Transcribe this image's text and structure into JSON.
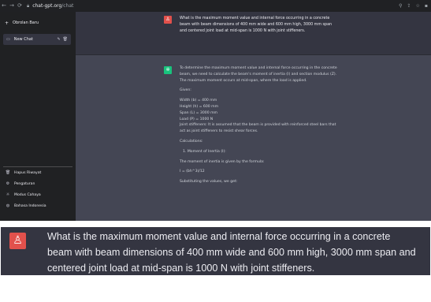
{
  "browser": {
    "back_icon": "back-arrow-icon",
    "forward_icon": "forward-arrow-icon",
    "reload_icon": "reload-icon",
    "url_host": "chat-gpt.org",
    "url_path": "/chat",
    "right_icons": [
      "search-icon",
      "share-icon",
      "star-icon",
      "extension-icon"
    ]
  },
  "sidebar": {
    "new_chat_label": "Obrolan Baru",
    "chat_items": [
      {
        "label": "New Chat"
      }
    ],
    "footer": [
      {
        "label": "Hapus Riwayat",
        "icon": "trash-icon"
      },
      {
        "label": "Pengaturan",
        "icon": "settings-icon"
      },
      {
        "label": "Modus Cahaya",
        "icon": "sun-icon"
      },
      {
        "label": "Bahasa Indonesia",
        "icon": "globe-icon"
      }
    ]
  },
  "conversation": {
    "user_message": "What is the maximum moment value and internal force occurring in a concrete beam with beam dimensions of 400 mm wide and 600 mm high, 3000 mm span and centered joint load at mid-span is 1000 N with joint stiffeners.",
    "bot_paragraphs": [
      "To determine the maximum moment value and internal force occurring in the concrete beam, we need to calculate the beam's moment of inertia (I) and section modulus (Z). The maximum moment occurs at mid-span, where the load is applied.",
      "Given:",
      "Width (b) = 400 mm\nHeight (h) = 600 mm\nSpan (L) = 3000 mm\nLoad (P) = 1000 N\nJoint stiffeners: It is assumed that the beam is provided with reinforced steel bars that act as joint stiffeners to resist shear forces.",
      "Calculations:",
      "1.  Moment of Inertia (I):",
      "The moment of inertia is given by the formula:",
      "I = (bh^3)/12",
      "Substituting the values, we get:"
    ]
  },
  "zoom": {
    "user_message": "What is the maximum moment value and internal force occurring in a concrete beam with beam dimensions of 400 mm wide and 600 mm high, 3000 mm span and centered joint load at mid-span is 1000 N with joint stiffeners."
  },
  "colors": {
    "sidebar_bg": "#202123",
    "chat_bg": "#343541",
    "bot_bg": "#444654",
    "user_avatar": "#e2514c",
    "bot_avatar": "#19c37d"
  }
}
